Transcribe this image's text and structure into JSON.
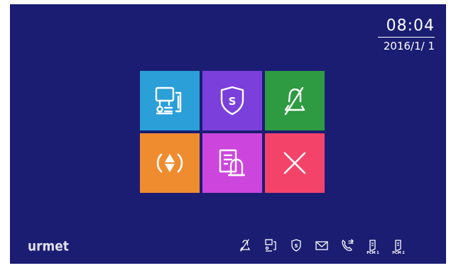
{
  "clock": {
    "time": "08:04",
    "date": "2016/1/ 1"
  },
  "tiles": [
    {
      "name": "intercom",
      "color": "#2a9fd8",
      "icon": "intercom-icon"
    },
    {
      "name": "security",
      "color": "#7b3fdc",
      "icon": "security-shield-icon",
      "letter": "S"
    },
    {
      "name": "do-not-disturb",
      "color": "#2e9a42",
      "icon": "bell-muted-icon"
    },
    {
      "name": "divert",
      "color": "#f08c30",
      "icon": "divert-icon"
    },
    {
      "name": "messages",
      "color": "#cc46dd",
      "icon": "memo-icon"
    },
    {
      "name": "exit",
      "color": "#f44368",
      "icon": "close-icon"
    }
  ],
  "brand": {
    "logo": "urmet"
  },
  "status_bar": {
    "icons": [
      {
        "icon": "bell-muted-icon"
      },
      {
        "icon": "intercom-icon"
      },
      {
        "icon": "security-shield-icon",
        "letter": "S"
      },
      {
        "icon": "envelope-icon"
      },
      {
        "icon": "call-forward-icon"
      },
      {
        "icon": "pcm-icon",
        "label": "PCM 1"
      },
      {
        "icon": "pcm-icon",
        "label": "PCM 2"
      }
    ]
  }
}
